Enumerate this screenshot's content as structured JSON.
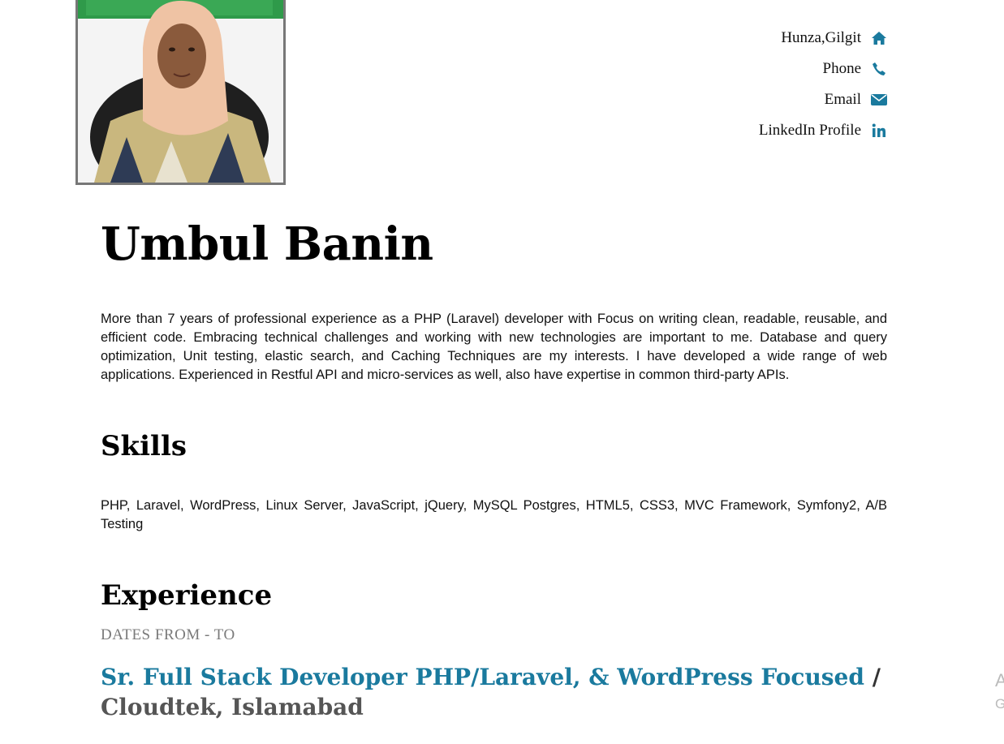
{
  "profile": {
    "photo_alt": "Profile photo"
  },
  "contact": [
    {
      "label": "Hunza,Gilgit",
      "icon": "home-icon"
    },
    {
      "label": "Phone",
      "icon": "phone-icon"
    },
    {
      "label": "Email",
      "icon": "envelope-icon"
    },
    {
      "label": "LinkedIn Profile",
      "icon": "linkedin-icon"
    }
  ],
  "name": "Umbul Banin",
  "summary": "More than 7 years of professional experience as a PHP (Laravel) developer with Focus on writing clean, readable, reusable, and efficient code. Embracing technical challenges and working with new technologies are important to me. Database and query optimization, Unit testing, elastic search, and Caching Techniques are my interests. I have developed a wide range of web applications. Experienced in Restful API and micro-services as well, also have expertise in common third-party APIs.",
  "skills": {
    "heading": "Skills",
    "text": "PHP, Laravel, WordPress, Linux Server, JavaScript, jQuery, MySQL Postgres, HTML5, CSS3, MVC Framework, Symfony2,  A/B Testing"
  },
  "experience": {
    "heading": "Experience",
    "dates": "DATES FROM - TO",
    "jobs": [
      {
        "role": "Sr. Full Stack Developer PHP/Laravel, & WordPress Focused",
        "separator": " / ",
        "company": "Cloudtek, Islamabad"
      }
    ]
  },
  "edge_text": {
    "a": "A",
    "g": "G"
  },
  "colors": {
    "accent": "#1a7a9e",
    "icon": "#1a7a9e",
    "dates": "#7a7a7a",
    "company": "#555555"
  }
}
